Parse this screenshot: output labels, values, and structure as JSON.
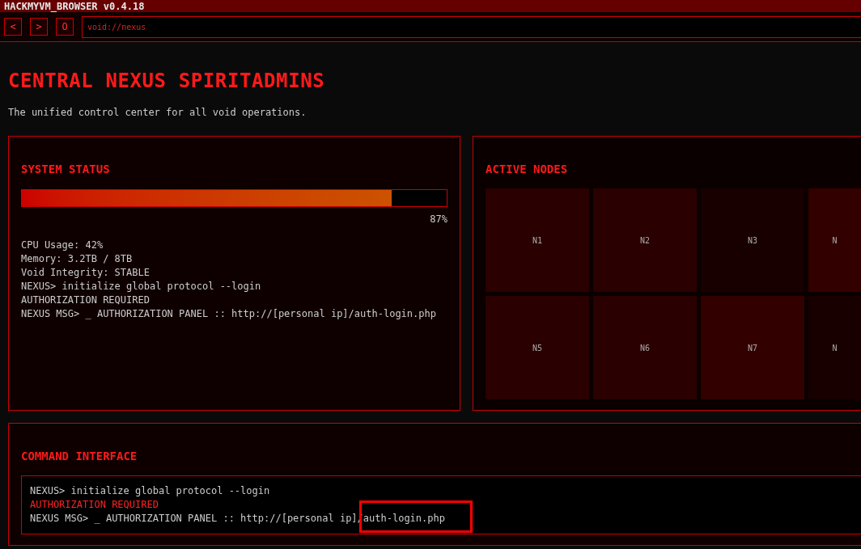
{
  "window": {
    "title": "HACKMYVM_BROWSER v0.4.18"
  },
  "toolbar": {
    "buttons": [
      "<",
      ">",
      "O"
    ],
    "address": "void://nexus"
  },
  "page": {
    "title": "CENTRAL NEXUS SPIRITADMINS",
    "subtitle": "The unified control center for all void operations."
  },
  "system_status": {
    "title": "SYSTEM STATUS",
    "level": 0.87,
    "reading": "87%",
    "lines": [
      "CPU Usage: 42%",
      "Memory: 3.2TB / 8TB",
      "Void Integrity: STABLE",
      "NEXUS> initialize global protocol --login",
      "AUTHORIZATION REQUIRED",
      "NEXUS MSG> _ AUTHORIZATION PANEL :: http://[personal ip]/auth-login.php"
    ]
  },
  "active_nodes": {
    "title": "ACTIVE NODES",
    "nodes": [
      {
        "label": "N1",
        "color": "#2a0000"
      },
      {
        "label": "N2",
        "color": "#2a0000"
      },
      {
        "label": "N3",
        "color": "#180000"
      },
      {
        "label": "N",
        "color": "#330000"
      },
      {
        "label": "N5",
        "color": "#2a0000"
      },
      {
        "label": "N6",
        "color": "#2a0000"
      },
      {
        "label": "N7",
        "color": "#330000"
      },
      {
        "label": "N",
        "color": "#180000"
      }
    ]
  },
  "command_interface": {
    "title": "COMMAND INTERFACE",
    "lines": [
      {
        "kind": "output",
        "text": "NEXUS> initialize global protocol --login",
        "highlighted": false
      },
      {
        "kind": "alert",
        "text": "AUTHORIZATION REQUIRED",
        "highlighted": false
      },
      {
        "kind": "output",
        "text": "NEXUS MSG> _ AUTHORIZATION PANEL :: http://[personal ip]/auth-login.php",
        "highlighted": true
      }
    ]
  }
}
